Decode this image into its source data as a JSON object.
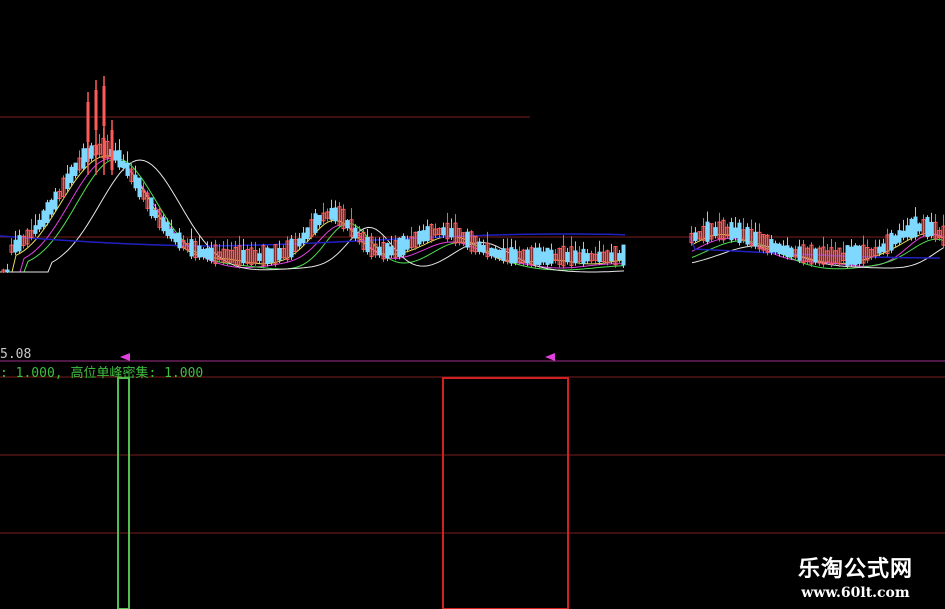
{
  "colors": {
    "background": "#000000",
    "grid": "#7a1e1e",
    "separator": "#a0308a",
    "candle_up": "#ff5a5a",
    "candle_down": "#7fd8ff",
    "ma_white": "#e8e8e8",
    "ma_yellow": "#e8e060",
    "ma_magenta": "#e040e0",
    "ma_green": "#50e050",
    "ma_blue": "#2020c0",
    "signal_green": "#4fbf4f",
    "signal_red": "#d02020",
    "indicator_text": "#3fbf3f"
  },
  "price_panel": {
    "price_label": "5.08"
  },
  "indicator_panel": {
    "text": ": 1.000, 高位单峰密集: 1.000",
    "signal_green": 1.0,
    "signal_red": 1.0
  },
  "watermark": {
    "title": "乐淘公式网",
    "url": "www.60lt.com"
  }
}
